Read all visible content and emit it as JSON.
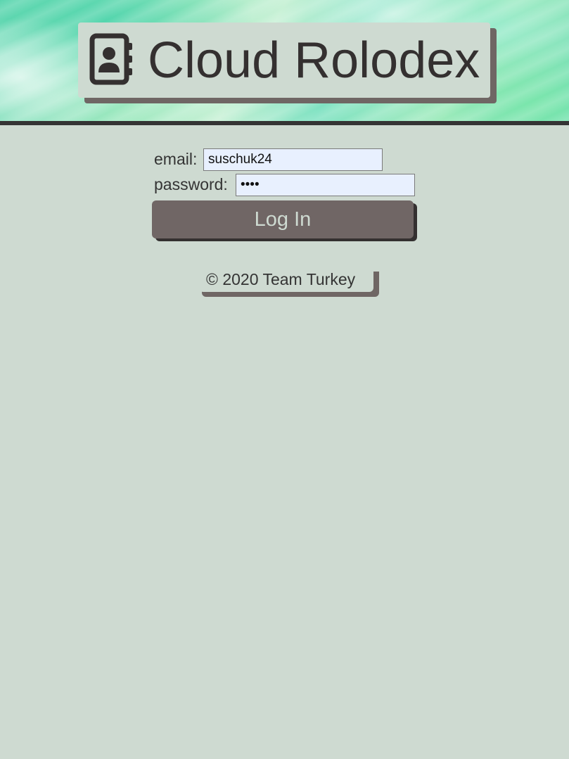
{
  "header": {
    "title": "Cloud Rolodex",
    "icon": "address-book-icon"
  },
  "login_form": {
    "email_label": "email:",
    "email_value": "suschuk24",
    "password_label": "password:",
    "password_value": "••••",
    "submit_label": "Log In"
  },
  "footer": {
    "copyright": "© 2020 Team Turkey"
  },
  "colors": {
    "background": "#cedad1",
    "dark": "#343434",
    "button": "#706665",
    "input_fill": "#e8f0fe"
  }
}
